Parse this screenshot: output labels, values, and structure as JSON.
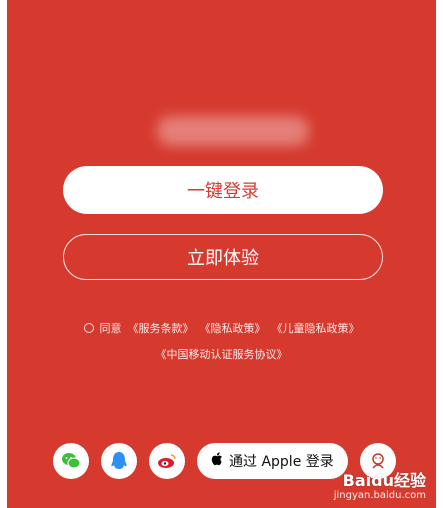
{
  "phone_blurred": "",
  "buttons": {
    "one_click_login": "一键登录",
    "try_now": "立即体验"
  },
  "agreement": {
    "prefix": "同意",
    "terms": "《服务条款》",
    "privacy": "《隐私政策》",
    "child_privacy": "《儿童隐私政策》",
    "cmcc": "《中国移动认证服务协议》"
  },
  "social": {
    "apple_label": "通过 Apple 登录"
  },
  "watermark": {
    "brand": "Baidu经验",
    "url": "jingyan.baidu.com"
  }
}
